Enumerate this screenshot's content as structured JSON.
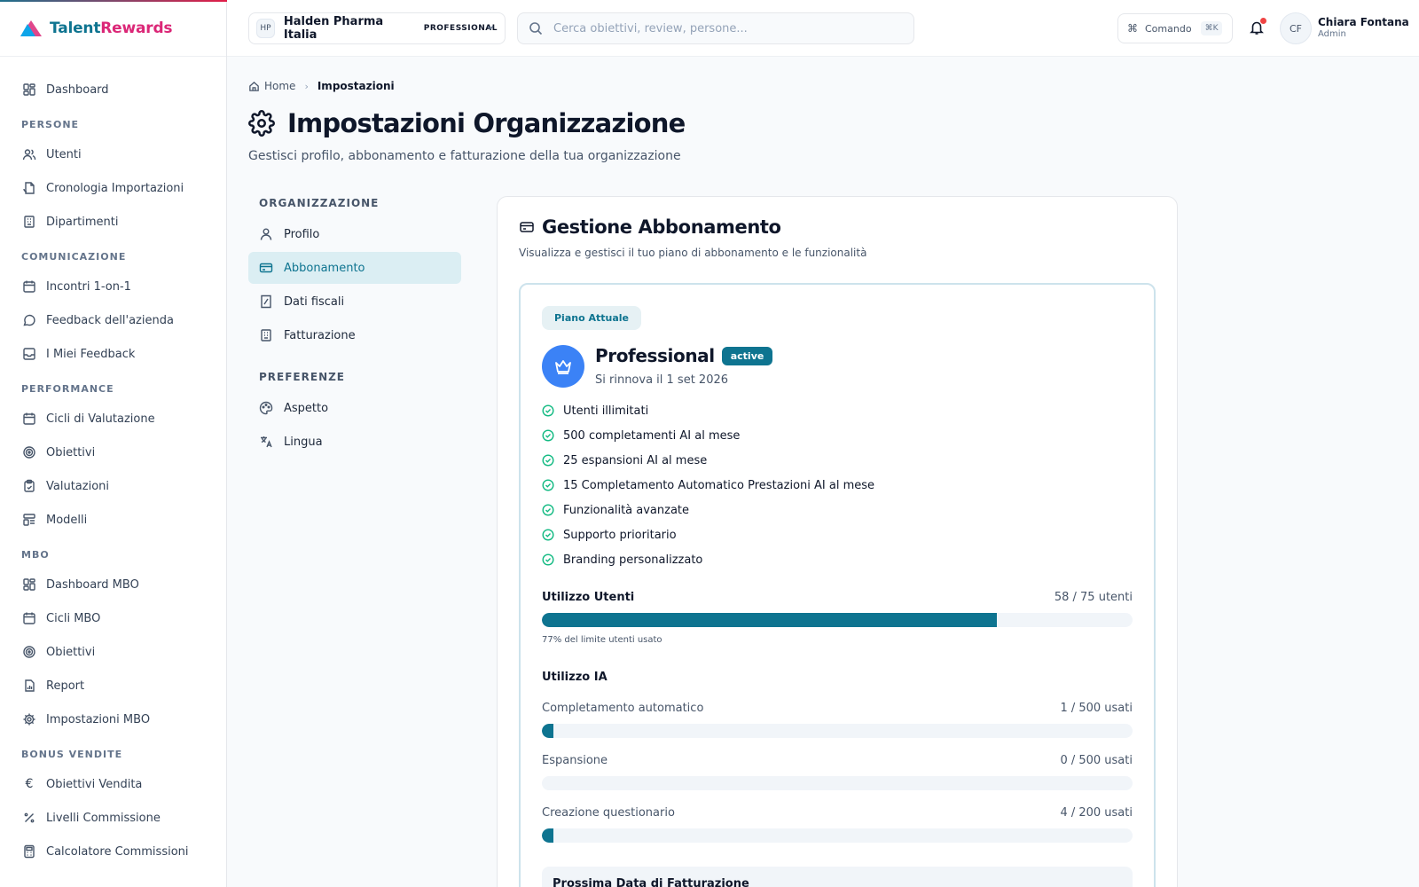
{
  "brand": {
    "part1": "Talent",
    "part2": "Rewards"
  },
  "sidebar": {
    "top": [
      {
        "label": "Dashboard",
        "icon": "dashboard-icon"
      }
    ],
    "sections": [
      {
        "label": "PERSONE",
        "items": [
          {
            "label": "Utenti",
            "icon": "users-icon"
          },
          {
            "label": "Cronologia Importazioni",
            "icon": "file-history-icon"
          },
          {
            "label": "Dipartimenti",
            "icon": "building-icon"
          }
        ]
      },
      {
        "label": "COMUNICAZIONE",
        "items": [
          {
            "label": "Incontri 1-on-1",
            "icon": "calendar-icon"
          },
          {
            "label": "Feedback dell'azienda",
            "icon": "message-icon"
          },
          {
            "label": "I Miei Feedback",
            "icon": "inbox-icon"
          }
        ]
      },
      {
        "label": "PERFORMANCE",
        "items": [
          {
            "label": "Cicli di Valutazione",
            "icon": "calendar-icon"
          },
          {
            "label": "Obiettivi",
            "icon": "target-icon"
          },
          {
            "label": "Valutazioni",
            "icon": "clipboard-check-icon"
          },
          {
            "label": "Modelli",
            "icon": "template-icon"
          }
        ]
      },
      {
        "label": "MBO",
        "items": [
          {
            "label": "Dashboard MBO",
            "icon": "dashboard-icon"
          },
          {
            "label": "Cicli MBO",
            "icon": "calendar-icon"
          },
          {
            "label": "Obiettivi",
            "icon": "target-icon"
          },
          {
            "label": "Report",
            "icon": "report-icon"
          },
          {
            "label": "Impostazioni MBO",
            "icon": "gear-icon"
          }
        ]
      },
      {
        "label": "BONUS VENDITE",
        "items": [
          {
            "label": "Obiettivi Vendita",
            "icon": "euro-icon"
          },
          {
            "label": "Livelli Commissione",
            "icon": "percent-icon"
          },
          {
            "label": "Calcolatore Commissioni",
            "icon": "calculator-icon"
          }
        ]
      }
    ]
  },
  "header": {
    "org_initials": "HP",
    "org_name": "Halden Pharma Italia",
    "org_plan": "PROFESSIONAL",
    "search_placeholder": "Cerca obiettivi, review, persone...",
    "command_label": "Comando",
    "command_kbd": "⌘K",
    "user_initials": "CF",
    "user_name": "Chiara Fontana",
    "user_role": "Admin"
  },
  "breadcrumb": {
    "home": "Home",
    "current": "Impostazioni"
  },
  "page": {
    "title": "Impostazioni Organizzazione",
    "subtitle": "Gestisci profilo, abbonamento e fatturazione della tua organizzazione"
  },
  "settings_nav": {
    "group1": "ORGANIZZAZIONE",
    "items1": [
      {
        "label": "Profilo",
        "icon": "user-icon",
        "active": false
      },
      {
        "label": "Abbonamento",
        "icon": "credit-card-icon",
        "active": true
      },
      {
        "label": "Dati fiscali",
        "icon": "receipt-icon",
        "active": false
      },
      {
        "label": "Fatturazione",
        "icon": "building-icon",
        "active": false
      }
    ],
    "group2": "PREFERENZE",
    "items2": [
      {
        "label": "Aspetto",
        "icon": "palette-icon",
        "active": false
      },
      {
        "label": "Lingua",
        "icon": "language-icon",
        "active": false
      }
    ]
  },
  "subscription": {
    "title": "Gestione Abbonamento",
    "subtitle": "Visualizza e gestisci il tuo piano di abbonamento e le funzionalità",
    "current_label": "Piano Attuale",
    "plan_name": "Professional",
    "status": "active",
    "renewal": "Si rinnova il 1 set 2026",
    "features": [
      "Utenti illimitati",
      "500 completamenti AI al mese",
      "25 espansioni AI al mese",
      "15 Completamento Automatico Prestazioni AI al mese",
      "Funzionalità avanzate",
      "Supporto prioritario",
      "Branding personalizzato"
    ],
    "users_label": "Utilizzo Utenti",
    "users_value": "58 / 75 utenti",
    "users_fraction": 0.77,
    "users_note": "77% del limite utenti usato",
    "ai_label": "Utilizzo IA",
    "ai_usage": [
      {
        "label": "Completamento automatico",
        "value": "1 / 500 usati",
        "fraction": 0.002
      },
      {
        "label": "Espansione",
        "value": "0 / 500 usati",
        "fraction": 0
      },
      {
        "label": "Creazione questionario",
        "value": "4 / 200 usati",
        "fraction": 0.02
      }
    ],
    "next_billing_label": "Prossima Data di Fatturazione"
  }
}
